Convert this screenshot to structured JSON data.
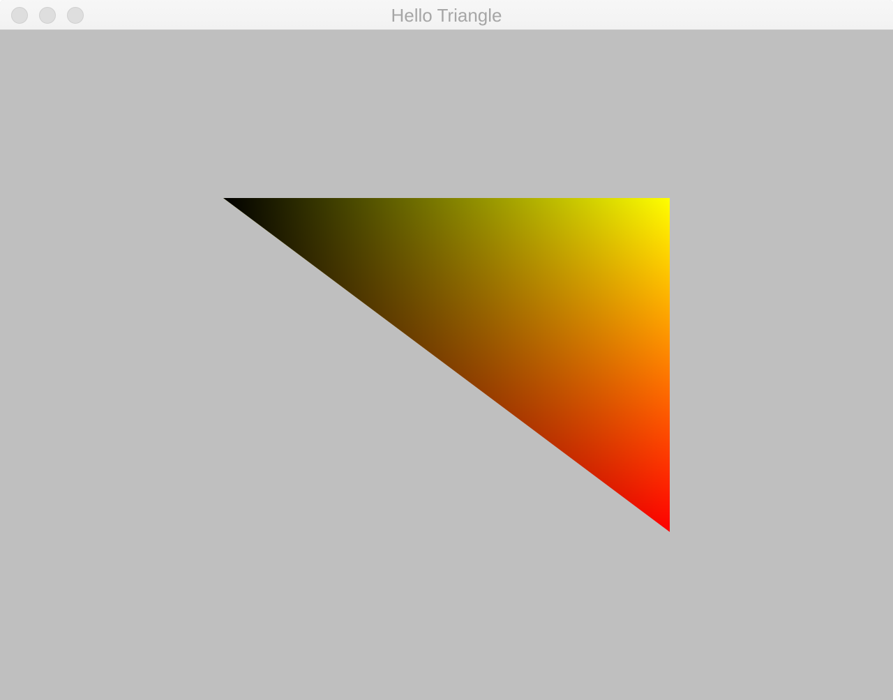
{
  "window": {
    "title": "Hello Triangle",
    "controls": [
      "close-button",
      "minimize-button",
      "zoom-button"
    ]
  },
  "scene": {
    "clear_color": "#bfbfbf",
    "triangle": {
      "shape": "right triangle",
      "vertex_colors": {
        "top_left": "#000000",
        "top_right": "#ffff00",
        "bottom_right": "#ff0000"
      }
    }
  }
}
